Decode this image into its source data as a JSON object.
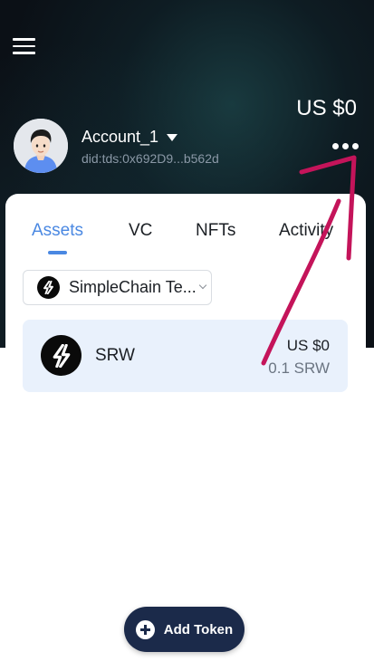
{
  "header": {
    "menu_icon": "hamburger-menu-icon",
    "balance": "US $0"
  },
  "account": {
    "name": "Account_1",
    "did": "did:tds:0x692D9...b562d",
    "avatar_icon": "user-avatar-icon",
    "more_icon": "more-horizontal-icon"
  },
  "tabs": [
    {
      "label": "Assets",
      "active": true
    },
    {
      "label": "VC",
      "active": false
    },
    {
      "label": "NFTs",
      "active": false
    },
    {
      "label": "Activity",
      "active": false
    }
  ],
  "network": {
    "name": "SimpleChain Te...",
    "icon": "simplechain-logo-icon"
  },
  "tokens": [
    {
      "symbol": "SRW",
      "usd_value": "US $0",
      "amount": "0.1 SRW",
      "icon": "srw-token-logo-icon"
    }
  ],
  "add_token": {
    "label": "Add Token",
    "icon": "plus-circle-icon"
  },
  "annotation": {
    "arrow_color": "#c4145a"
  },
  "colors": {
    "accent": "#4a88e2",
    "header_bg": "#0b1016",
    "token_row_bg": "#e9f1fc",
    "button_bg": "#1b2a4a"
  }
}
